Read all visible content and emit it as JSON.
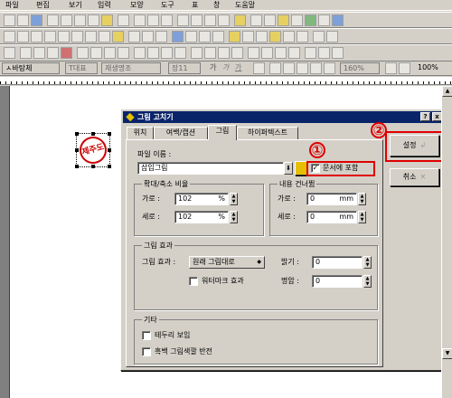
{
  "menubar": {
    "items": [
      "파일",
      "편집",
      "보기",
      "입력",
      "모양",
      "도구",
      "표",
      "창",
      "도움말"
    ]
  },
  "formatbar": {
    "style": "ㅅ바탕체",
    "font": "T대표",
    "font2": "재생명조",
    "size": "장11",
    "bold": "가",
    "italic": "가",
    "under": "가",
    "ratio": "160%",
    "ratio2": "100%"
  },
  "document": {
    "stamp_text": "제주도"
  },
  "dialog": {
    "title": "그림 고치기",
    "help_label": "?",
    "close_label": "x",
    "tabs": [
      "위치",
      "여백/캡션",
      "그림",
      "하이퍼텍스트"
    ],
    "file_name_label": "파일 이름 :",
    "file_name_value": "삽입그림",
    "include_doc_label": "문서에 포함",
    "scale_group": "확대/축소 비율",
    "horiz_label": "가로 :",
    "vert_label": "세로 :",
    "scale_h": "102",
    "scale_v": "102",
    "pct": "%",
    "skip_group": "내용 건너뜀",
    "skip_h": "0",
    "skip_v": "0",
    "mm": "mm",
    "effect_group": "그림 효과",
    "effect_label": "그림 효과 :",
    "effect_value": "원래 그림대로",
    "watermark_label": "워터마크 효과",
    "brightness_label": "밝기 :",
    "brightness_value": "0",
    "contrast_label": "명암 :",
    "contrast_value": "0",
    "misc_group": "기타",
    "border_label": "테두리 보임",
    "invert_label": "흑백 그림색깔 반전",
    "ok_label": "설정",
    "cancel_label": "취소"
  },
  "callouts": {
    "one": "①",
    "two": "②"
  },
  "colors": {
    "highlight": "#e00000",
    "titlebar": "#0a246a"
  }
}
